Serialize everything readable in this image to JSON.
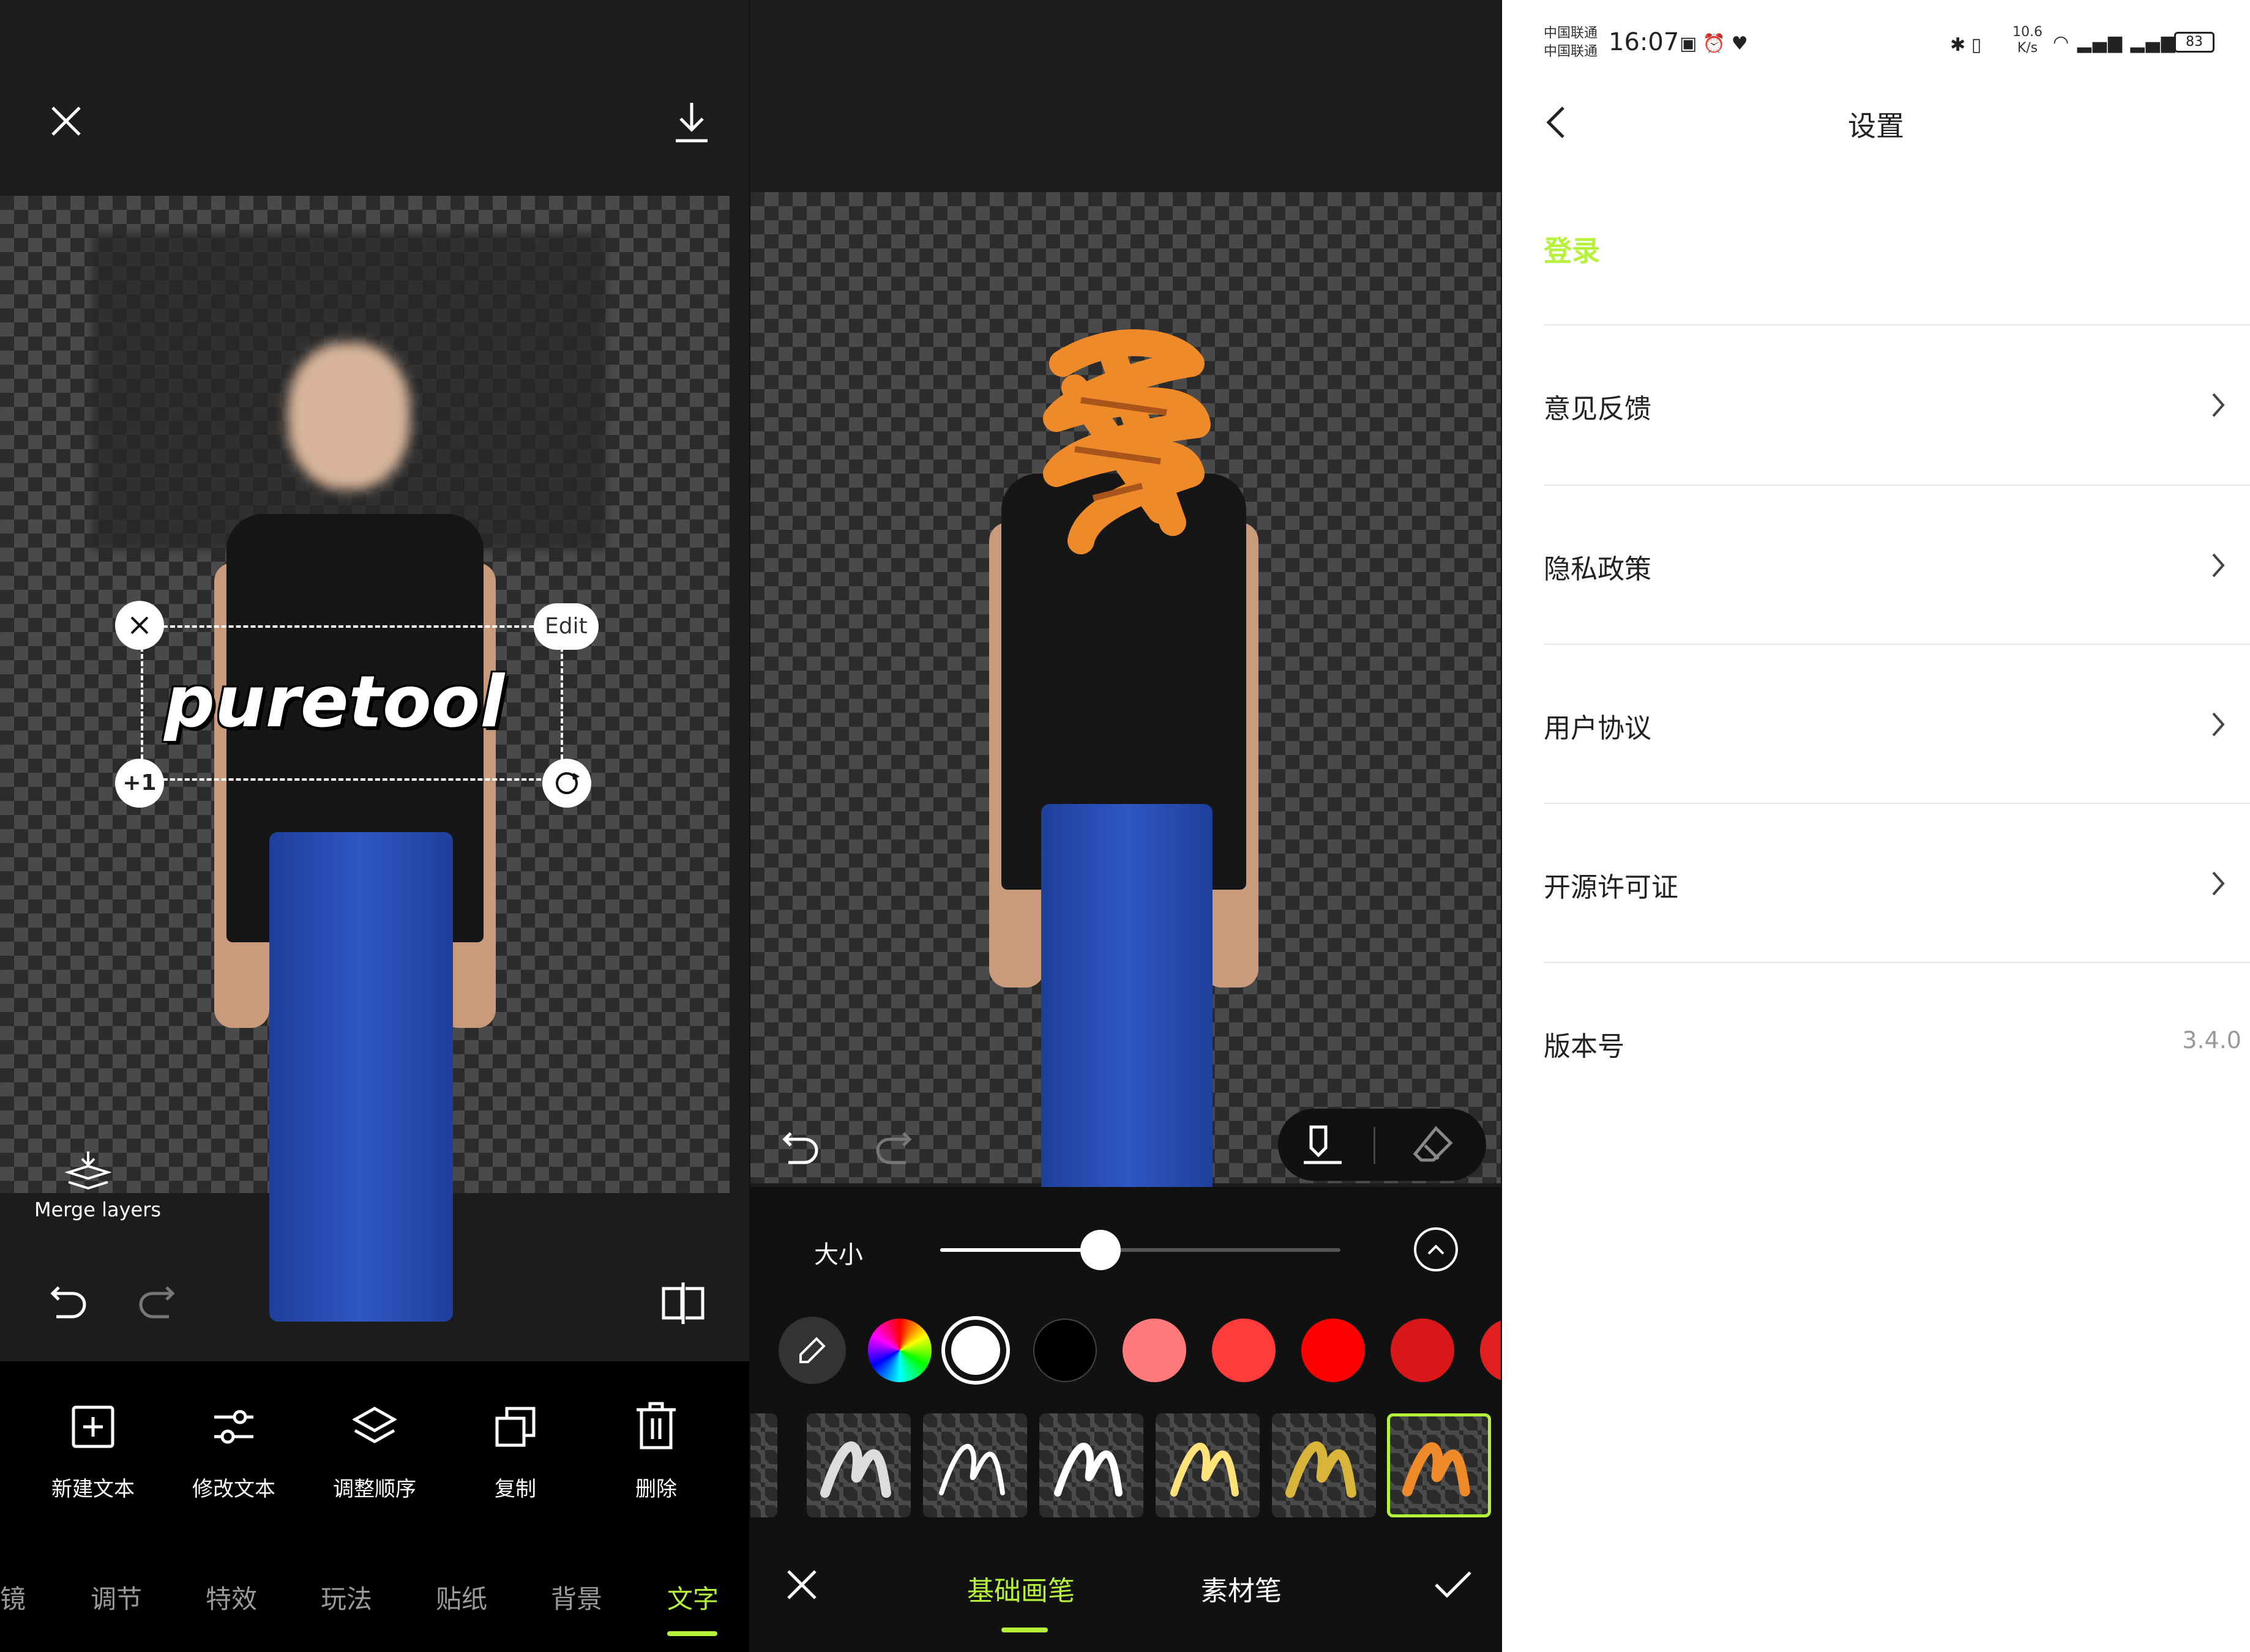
{
  "panel_editor": {
    "canvas_text": "puretool",
    "handle_edit": "Edit",
    "handle_plus": "+1",
    "merge_label": "Merge layers",
    "tools": [
      {
        "label": "新建文本",
        "icon": "add-text-icon"
      },
      {
        "label": "修改文本",
        "icon": "sliders-icon"
      },
      {
        "label": "调整顺序",
        "icon": "layers-icon"
      },
      {
        "label": "复制",
        "icon": "copy-icon"
      },
      {
        "label": "删除",
        "icon": "trash-icon"
      }
    ],
    "tabs": [
      "镜",
      "调节",
      "特效",
      "玩法",
      "贴纸",
      "背景",
      "文字"
    ],
    "active_tab": "文字",
    "accent": "#b7f23a"
  },
  "panel_brush": {
    "size_label": "大小",
    "size_value": 0.4,
    "colors": [
      "rainbow",
      "#ffffff",
      "#000000",
      "#ff7a7a",
      "#ff3b3b",
      "#ff0000",
      "#d81818",
      "#e02020"
    ],
    "selected_color": "#ffffff",
    "brush_count": 6,
    "selected_brush": 6,
    "mode_tabs": [
      "基础画笔",
      "素材笔"
    ],
    "active_mode": "基础画笔"
  },
  "panel_settings": {
    "status": {
      "carrier1": "中国联通",
      "carrier2": "中国联通",
      "time": "16:07",
      "speed": "10.6",
      "speed_unit": "K/s",
      "battery": "83"
    },
    "title": "设置",
    "login": "登录",
    "items": [
      {
        "label": "意见反馈"
      },
      {
        "label": "隐私政策"
      },
      {
        "label": "用户协议"
      },
      {
        "label": "开源许可证"
      }
    ],
    "version_label": "版本号",
    "version_value": "3.4.0",
    "accent": "#b7f23a"
  }
}
